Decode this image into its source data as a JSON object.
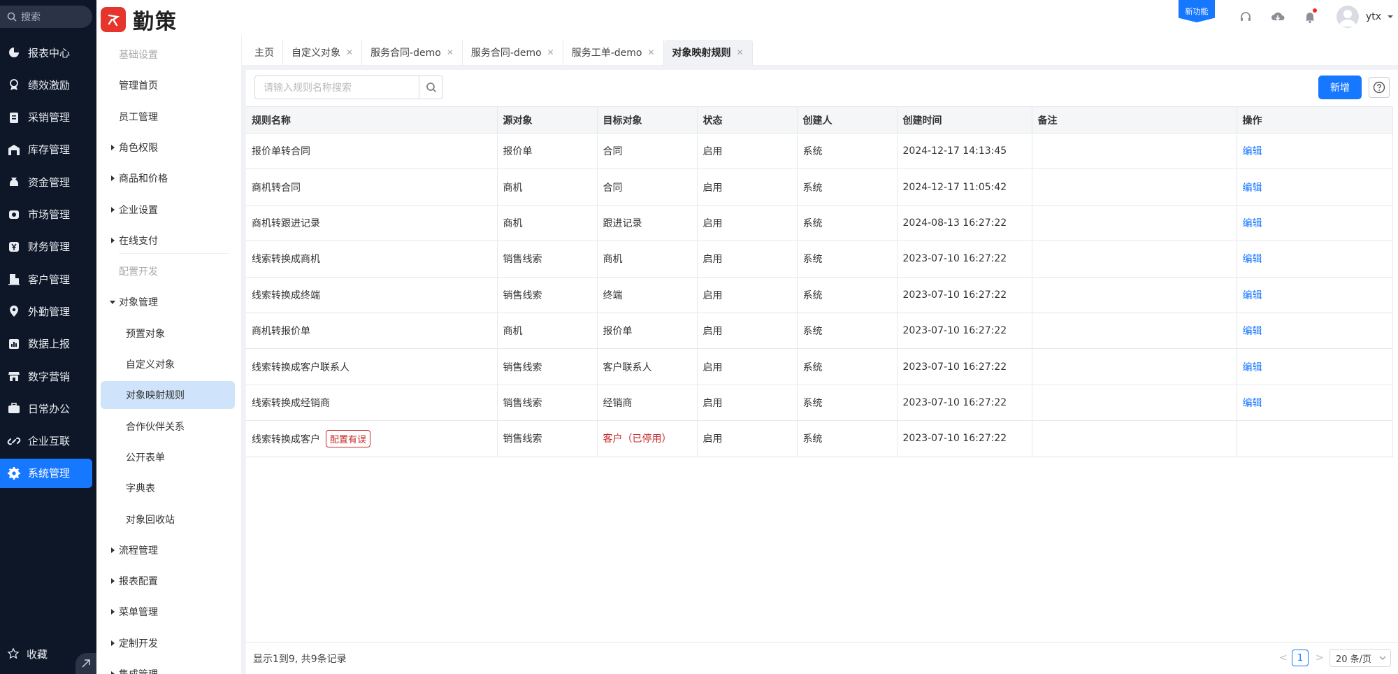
{
  "nav": {
    "search_label": "搜索",
    "items": [
      {
        "label": "报表中心",
        "icon": "pie-chart-icon"
      },
      {
        "label": "绩效激励",
        "icon": "medal-icon"
      },
      {
        "label": "采销管理",
        "icon": "clipboard-icon"
      },
      {
        "label": "库存管理",
        "icon": "warehouse-icon"
      },
      {
        "label": "资金管理",
        "icon": "money-bag-icon"
      },
      {
        "label": "市场管理",
        "icon": "market-icon"
      },
      {
        "label": "财务管理",
        "icon": "yen-icon"
      },
      {
        "label": "客户管理",
        "icon": "building-icon"
      },
      {
        "label": "外勤管理",
        "icon": "location-icon"
      },
      {
        "label": "数据上报",
        "icon": "report-icon"
      },
      {
        "label": "数字营销",
        "icon": "store-icon"
      },
      {
        "label": "日常办公",
        "icon": "briefcase-icon"
      },
      {
        "label": "企业互联",
        "icon": "link-icon"
      },
      {
        "label": "系统管理",
        "icon": "gear-icon",
        "active": true
      }
    ],
    "favorites_label": "收藏"
  },
  "header": {
    "logo_text": "勤策",
    "new_feature_label": "新功能",
    "username": "ytx"
  },
  "submenu": {
    "group_basic": "基础设置",
    "items_basic": [
      "管理首页",
      "员工管理"
    ],
    "expandable_basic": [
      "角色权限",
      "商品和价格",
      "企业设置",
      "在线支付"
    ],
    "group_dev": "配置开发",
    "object_mgmt": "对象管理",
    "object_children": [
      "预置对象",
      "自定义对象",
      "对象映射规则",
      "合作伙伴关系",
      "公开表单",
      "字典表",
      "对象回收站"
    ],
    "expandable_dev": [
      "流程管理",
      "报表配置",
      "菜单管理",
      "定制开发"
    ],
    "cut_item": "集成管理"
  },
  "tabs": [
    {
      "label": "主页",
      "closable": false
    },
    {
      "label": "自定义对象",
      "closable": true
    },
    {
      "label": "服务合同-demo",
      "closable": true
    },
    {
      "label": "服务合同-demo",
      "closable": true
    },
    {
      "label": "服务工单-demo",
      "closable": true
    },
    {
      "label": "对象映射规则",
      "closable": true,
      "active": true
    }
  ],
  "toolbar": {
    "search_placeholder": "请输入规则名称搜索",
    "new_label": "新增"
  },
  "table": {
    "columns": [
      "规则名称",
      "源对象",
      "目标对象",
      "状态",
      "创建人",
      "创建时间",
      "备注",
      "操作"
    ],
    "rows": [
      {
        "name": "报价单转合同",
        "source": "报价单",
        "target": "合同",
        "status": "启用",
        "creator": "系统",
        "time": "2024-12-17 14:13:45",
        "remark": "",
        "action": "编辑"
      },
      {
        "name": "商机转合同",
        "source": "商机",
        "target": "合同",
        "status": "启用",
        "creator": "系统",
        "time": "2024-12-17 11:05:42",
        "remark": "",
        "action": "编辑"
      },
      {
        "name": "商机转跟进记录",
        "source": "商机",
        "target": "跟进记录",
        "status": "启用",
        "creator": "系统",
        "time": "2024-08-13 16:27:22",
        "remark": "",
        "action": "编辑"
      },
      {
        "name": "线索转换成商机",
        "source": "销售线索",
        "target": "商机",
        "status": "启用",
        "creator": "系统",
        "time": "2023-07-10 16:27:22",
        "remark": "",
        "action": "编辑"
      },
      {
        "name": "线索转换成终端",
        "source": "销售线索",
        "target": "终端",
        "status": "启用",
        "creator": "系统",
        "time": "2023-07-10 16:27:22",
        "remark": "",
        "action": "编辑"
      },
      {
        "name": "商机转报价单",
        "source": "商机",
        "target": "报价单",
        "status": "启用",
        "creator": "系统",
        "time": "2023-07-10 16:27:22",
        "remark": "",
        "action": "编辑"
      },
      {
        "name": "线索转换成客户联系人",
        "source": "销售线索",
        "target": "客户联系人",
        "status": "启用",
        "creator": "系统",
        "time": "2023-07-10 16:27:22",
        "remark": "",
        "action": "编辑"
      },
      {
        "name": "线索转换成经销商",
        "source": "销售线索",
        "target": "经销商",
        "status": "启用",
        "creator": "系统",
        "time": "2023-07-10 16:27:22",
        "remark": "",
        "action": "编辑"
      },
      {
        "name": "线索转换成客户",
        "badge": "配置有误",
        "source": "销售线索",
        "target": "客户（已停用）",
        "target_error": true,
        "status": "启用",
        "creator": "系统",
        "time": "2023-07-10 16:27:22",
        "remark": "",
        "action": ""
      }
    ]
  },
  "footer": {
    "total_text": "显示1到9, 共9条记录",
    "current_page": "1",
    "page_size": "20 条/页"
  },
  "colors": {
    "primary": "#1677ff",
    "sidebar_bg": "#0e1727",
    "error": "#c62828",
    "logo": "#e5352c"
  }
}
